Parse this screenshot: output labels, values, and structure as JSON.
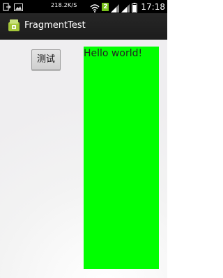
{
  "status_bar": {
    "network_speed": "218.2K/S",
    "network_badge": "2",
    "clock": "17:18",
    "icons_left": [
      "usb-icon",
      "image-icon"
    ],
    "icons_right": [
      "wifi-icon",
      "signal-icon",
      "signal-icon",
      "battery-icon"
    ]
  },
  "action_bar": {
    "app_icon": "android-app-icon",
    "title": "FragmentTest"
  },
  "content": {
    "button_label": "测试",
    "fragment_text": "Hello world!",
    "fragment_color": "#00ff00"
  }
}
